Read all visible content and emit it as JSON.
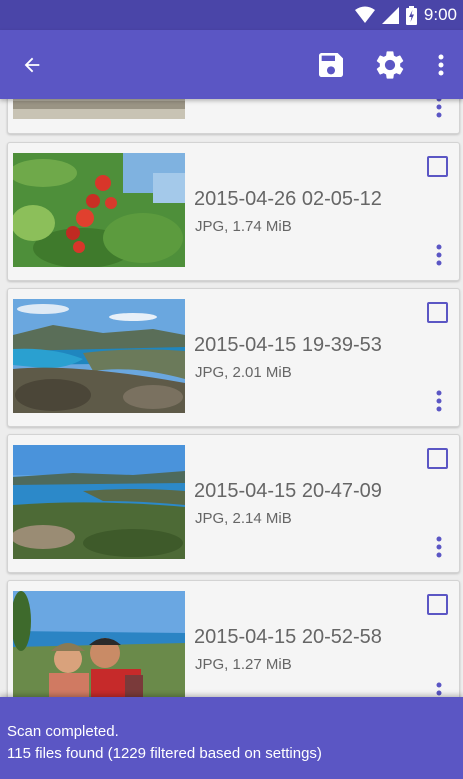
{
  "status_bar": {
    "time": "9:00",
    "icons": [
      "wifi-icon",
      "cell-signal-icon",
      "battery-charging-icon"
    ]
  },
  "toolbar": {
    "back_icon": "arrow-back-icon",
    "save_icon": "save-icon",
    "settings_icon": "gear-icon",
    "menu_icon": "more-vert-icon"
  },
  "files": [
    {
      "name": "",
      "info": "",
      "thumbnail": "partial-top-image",
      "checked": false
    },
    {
      "name": "2015-04-26 02-05-12",
      "info": "JPG, 1.74 MiB",
      "thumbnail": "red-flowers-photo",
      "checked": false
    },
    {
      "name": "2015-04-15 19-39-53",
      "info": "JPG, 2.01 MiB",
      "thumbnail": "bay-view-photo",
      "checked": false
    },
    {
      "name": "2015-04-15 20-47-09",
      "info": "JPG, 2.14 MiB",
      "thumbnail": "coast-view-photo",
      "checked": false
    },
    {
      "name": "2015-04-15 20-52-58",
      "info": "JPG, 1.27 MiB",
      "thumbnail": "selfie-photo",
      "checked": false
    }
  ],
  "snackbar": {
    "line1": "Scan completed.",
    "line2": "115 files found (1229 filtered based on settings)"
  },
  "colors": {
    "primary": "#5b56c4",
    "primary_dark": "#4a45a8",
    "text": "#666666",
    "background": "#ededed"
  }
}
